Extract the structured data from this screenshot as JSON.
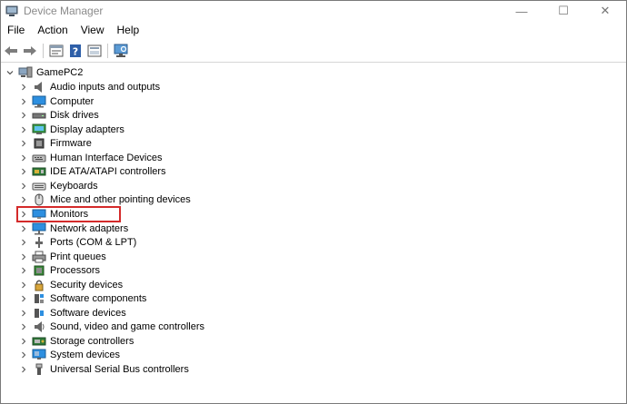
{
  "window": {
    "title": "Device Manager",
    "controls": {
      "minimize": "—",
      "maximize": "☐",
      "close": "✕"
    }
  },
  "menu": [
    "File",
    "Action",
    "View",
    "Help"
  ],
  "toolbar": [
    {
      "name": "back-icon"
    },
    {
      "name": "forward-icon"
    },
    {
      "name": "properties-icon"
    },
    {
      "name": "help-icon"
    },
    {
      "name": "update-driver-icon"
    },
    {
      "name": "scan-hardware-icon"
    }
  ],
  "tree": {
    "root": "GamePC2",
    "items": [
      {
        "label": "Audio inputs and outputs",
        "icon": "speaker-icon"
      },
      {
        "label": "Computer",
        "icon": "computer-icon"
      },
      {
        "label": "Disk drives",
        "icon": "disk-drive-icon"
      },
      {
        "label": "Display adapters",
        "icon": "display-adapter-icon"
      },
      {
        "label": "Firmware",
        "icon": "firmware-icon"
      },
      {
        "label": "Human Interface Devices",
        "icon": "hid-icon"
      },
      {
        "label": "IDE ATA/ATAPI controllers",
        "icon": "ide-controller-icon"
      },
      {
        "label": "Keyboards",
        "icon": "keyboard-icon"
      },
      {
        "label": "Mice and other pointing devices",
        "icon": "mouse-icon"
      },
      {
        "label": "Monitors",
        "icon": "monitor-icon"
      },
      {
        "label": "Network adapters",
        "icon": "network-adapter-icon"
      },
      {
        "label": "Ports (COM & LPT)",
        "icon": "port-icon"
      },
      {
        "label": "Print queues",
        "icon": "printer-icon"
      },
      {
        "label": "Processors",
        "icon": "processor-icon"
      },
      {
        "label": "Security devices",
        "icon": "security-device-icon"
      },
      {
        "label": "Software components",
        "icon": "software-component-icon"
      },
      {
        "label": "Software devices",
        "icon": "software-device-icon"
      },
      {
        "label": "Sound, video and game controllers",
        "icon": "sound-controller-icon"
      },
      {
        "label": "Storage controllers",
        "icon": "storage-controller-icon"
      },
      {
        "label": "System devices",
        "icon": "system-device-icon"
      },
      {
        "label": "Universal Serial Bus controllers",
        "icon": "usb-icon"
      }
    ]
  },
  "highlighted_item": "Monitors",
  "colors": {
    "highlight": "#d42a2a",
    "accent": "#1e88d8"
  }
}
